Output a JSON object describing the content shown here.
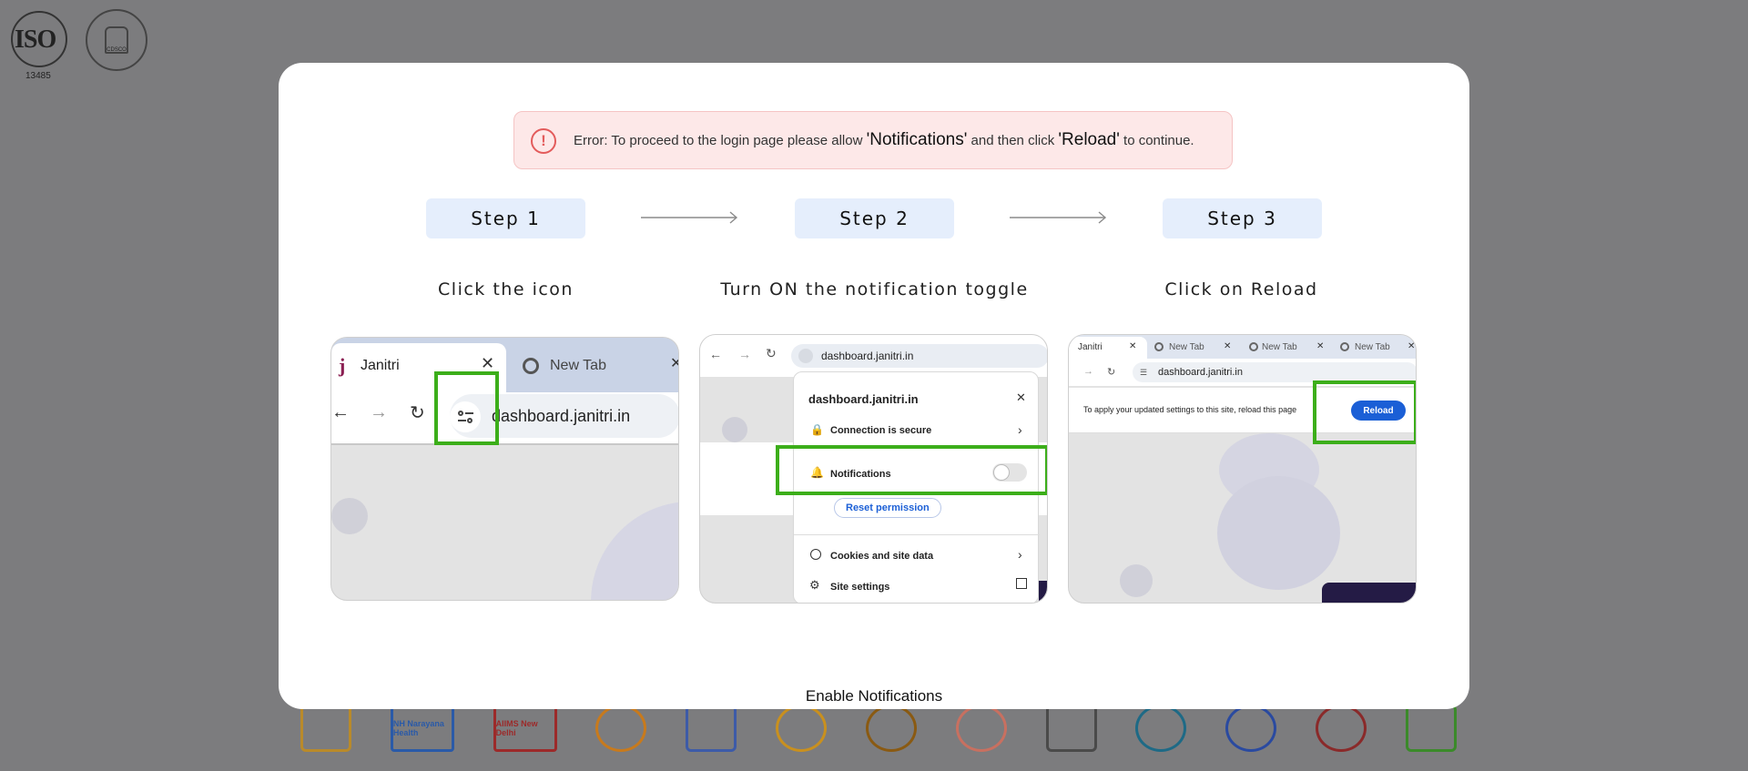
{
  "background": {
    "iso_logo": {
      "word": "ISO",
      "number": "13485"
    },
    "cdsco_logo": {
      "text": "CDSCO"
    },
    "partners": [
      {
        "text": "",
        "color": "#b98a2a"
      },
      {
        "text": "NH Narayana Health",
        "color": "#2a5aa8"
      },
      {
        "text": "AIIMS New Delhi",
        "color": "#9c2a2a"
      },
      {
        "text": "",
        "color": "#c87a1c"
      },
      {
        "text": "",
        "color": "#3d5ba8"
      },
      {
        "text": "",
        "color": "#c9901e"
      },
      {
        "text": "",
        "color": "#8a5a12"
      },
      {
        "text": "",
        "color": "#c87060"
      },
      {
        "text": "",
        "color": "#4a4a4a"
      },
      {
        "text": "",
        "color": "#1e6a86"
      },
      {
        "text": "",
        "color": "#2a4aa0"
      },
      {
        "text": "",
        "color": "#8a2a2a"
      },
      {
        "text": "",
        "color": "#3b8a2a"
      }
    ]
  },
  "modal": {
    "error": {
      "prefix": "Error: To proceed to the login page please allow ",
      "notifications_word": "'Notifications'",
      "middle": " and then click ",
      "reload_word": "'Reload'",
      "suffix": " to continue.",
      "icon": "exclamation-circle-icon",
      "color": "#e35b5b"
    },
    "steps": [
      {
        "label": "Step 1",
        "caption": "Click the icon"
      },
      {
        "label": "Step 2",
        "caption": "Turn ON the notification toggle"
      },
      {
        "label": "Step 3",
        "caption": "Click on Reload"
      }
    ],
    "shot1": {
      "tab_active": "Janitri",
      "tab_inactive": "New Tab",
      "url": "dashboard.janitri.in"
    },
    "shot2": {
      "url": "dashboard.janitri.in",
      "popup_title": "dashboard.janitri.in",
      "connection": "Connection is secure",
      "notifications": "Notifications",
      "reset": "Reset permission",
      "cookies": "Cookies and site data",
      "site_settings": "Site settings"
    },
    "shot3": {
      "tabs": [
        "Janitri",
        "New Tab",
        "New Tab",
        "New Tab"
      ],
      "url": "dashboard.janitri.in",
      "message": "To apply your updated settings to this site, reload this page",
      "reload_button": "Reload"
    },
    "enable_label": "Enable Notifications",
    "accent_green": "#3cae1a",
    "accent_blue": "#1b5fd6"
  }
}
